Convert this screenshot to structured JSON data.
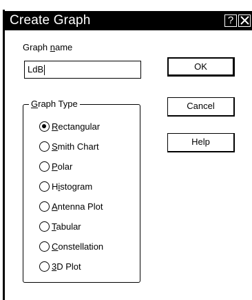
{
  "dialog": {
    "title": "Create Graph",
    "help_glyph": "?",
    "close_glyph": "X"
  },
  "graph_name": {
    "label_prefix": "Graph ",
    "label_mnemonic": "n",
    "label_suffix": "ame",
    "value": "LdB"
  },
  "buttons": {
    "ok": "OK",
    "cancel": "Cancel",
    "help": "Help"
  },
  "graph_type": {
    "legend_mnemonic": "G",
    "legend_suffix": "raph Type",
    "selected": "Rectangular",
    "options": [
      {
        "mnemonic": "R",
        "rest": "ectangular",
        "checked": true
      },
      {
        "mnemonic": "S",
        "rest": "mith Chart",
        "checked": false
      },
      {
        "mnemonic": "P",
        "rest": "olar",
        "checked": false
      },
      {
        "pre": "H",
        "mnemonic": "i",
        "rest": "stogram",
        "checked": false
      },
      {
        "mnemonic": "A",
        "rest": "ntenna Plot",
        "checked": false
      },
      {
        "mnemonic": "T",
        "rest": "abular",
        "checked": false
      },
      {
        "mnemonic": "C",
        "rest": "onstellation",
        "checked": false
      },
      {
        "mnemonic": "3",
        "rest": "D Plot",
        "checked": false
      }
    ]
  }
}
